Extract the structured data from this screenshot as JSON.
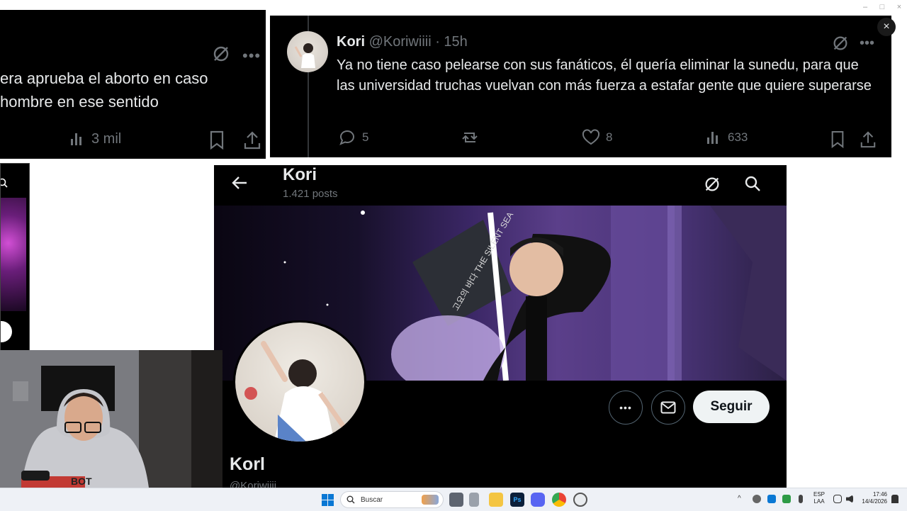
{
  "window": {
    "close_glyph": "×",
    "minimize_glyph": "–",
    "maximize_glyph": "□",
    "window_close_glyph": "×"
  },
  "tweet_left": {
    "lines": [
      "era aprueba el aborto en caso",
      "hombre en ese sentido"
    ],
    "views": "3 mil"
  },
  "tweet_right": {
    "name": "Kori",
    "handle": "@Koriwiiii",
    "time": "· 15h",
    "text": "Ya no tiene caso pelearse con sus fanáticos, él quería eliminar la sunedu, para que las universidad truchas vuelvan con más fuerza a estafar gente que quiere superarse",
    "replies": "5",
    "likes": "8",
    "views": "633"
  },
  "profile": {
    "header_name": "Kori",
    "posts_count": "1.421 posts",
    "display_name": "Korl",
    "handle": "@Koriwiiii",
    "follow_label": "Seguir",
    "banner_sign_text": "고요의 바다 THE SILENT SEA"
  },
  "taskbar": {
    "search_placeholder": "Buscar",
    "lang_top": "ESP",
    "lang_bottom": "LAA",
    "time": "17:46",
    "date": "14/4/2026"
  },
  "colors": {
    "x_bg": "#000000",
    "text": "#e7e9ea",
    "muted": "#71767b",
    "banner_purple": "#5b3f8a"
  }
}
